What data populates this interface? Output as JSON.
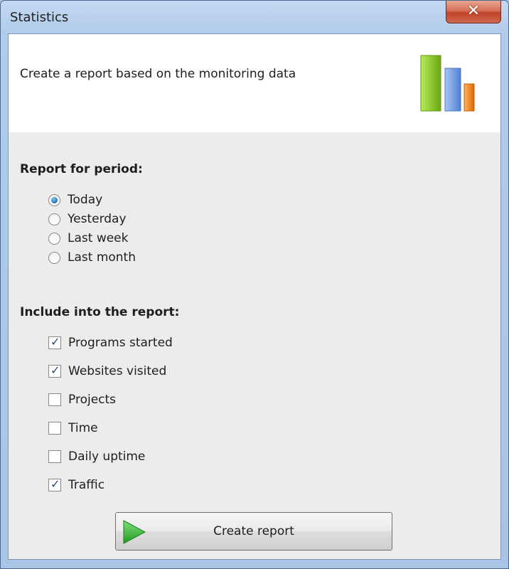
{
  "window": {
    "title": "Statistics",
    "close_glyph": "✕"
  },
  "header": {
    "text": "Create a report based on the monitoring data",
    "icon": "bar-chart-icon"
  },
  "period": {
    "label": "Report for period:",
    "options": [
      {
        "label": "Today",
        "selected": true
      },
      {
        "label": "Yesterday",
        "selected": false
      },
      {
        "label": "Last week",
        "selected": false
      },
      {
        "label": "Last month",
        "selected": false
      }
    ]
  },
  "include": {
    "label": "Include into the report:",
    "items": [
      {
        "label": "Programs started",
        "checked": true
      },
      {
        "label": "Websites visited",
        "checked": true
      },
      {
        "label": "Projects",
        "checked": false
      },
      {
        "label": "Time",
        "checked": false
      },
      {
        "label": "Daily uptime",
        "checked": false
      },
      {
        "label": "Traffic",
        "checked": true
      }
    ]
  },
  "check_glyph": "✓",
  "create_button": {
    "label": "Create report",
    "icon": "play-icon"
  },
  "colors": {
    "accent_green": "#3db23d",
    "bar_green": "#8ccc22",
    "bar_blue": "#6f9ee8",
    "bar_orange": "#f08a1c"
  }
}
